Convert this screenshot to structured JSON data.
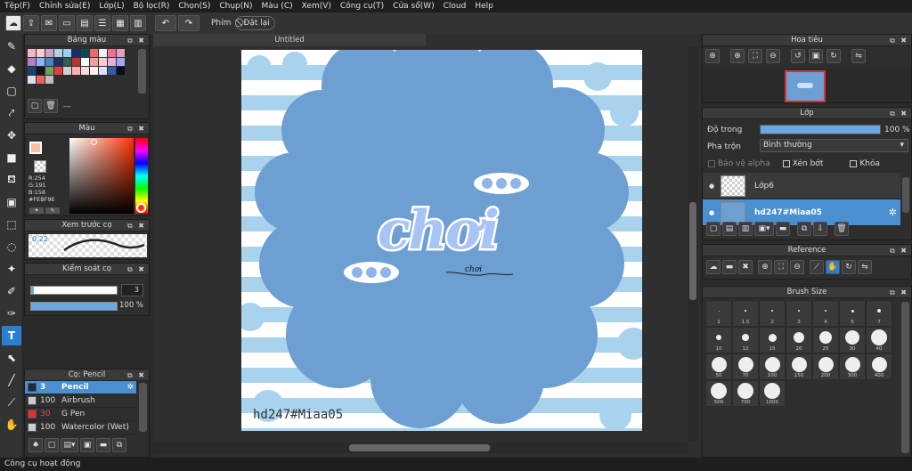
{
  "menu": [
    "Tệp(F)",
    "Chỉnh sửa(E)",
    "Lớp(L)",
    "Bộ lọc(R)",
    "Chọn(S)",
    "Chụp(N)",
    "Màu (C)",
    "Xem(V)",
    "Công cụ(T)",
    "Cửa sổ(W)",
    "Cloud",
    "Help"
  ],
  "toolbar": {
    "keys_label": "Phím",
    "reset_label": "Đặt lại"
  },
  "palette": {
    "title": "Bảng màu",
    "colors": [
      "#f4b6c2",
      "#f9c9d4",
      "#c8a2c8",
      "#b0d0e8",
      "#9ad0f0",
      "#1a2a6a",
      "#0a4a5a",
      "#e86a6a",
      "#f0f0f0",
      "#f07090",
      "#e0a0c0",
      "#b080c0",
      "#8ab4f8",
      "#5080c0",
      "#203060",
      "#306050",
      "#c03030",
      "#ffffff",
      "#f0a0a0",
      "#f8d0d0",
      "#e8b0e0",
      "#a0a8f0",
      "#204070",
      "#101820",
      "#70a060",
      "#e04040",
      "#d0d0d0",
      "#ffb0b0",
      "#ffd8e0",
      "#fff0f0",
      "#e0e0ff",
      "#3060a0",
      "#0a0a20",
      "#d8e0f0",
      "#f06060",
      "#c0c0c0"
    ],
    "footer_label": "---"
  },
  "color_panel": {
    "title": "Màu",
    "r": "R:254",
    "g": "G:191",
    "b": "B:158",
    "hex": "#FEBF9E",
    "main_color": "#febf9e",
    "hue_color": "#ff3300"
  },
  "brush_preview": {
    "title": "Xem trước cọ",
    "size_value": "0.22"
  },
  "brush_control": {
    "title": "Kiểm soát cọ",
    "size": "3",
    "opacity": "100 %",
    "size_fraction": 0.03,
    "opacity_fraction": 1.0
  },
  "brush_list": {
    "title": "Cọ: Pencil",
    "items": [
      {
        "size": "3",
        "name": "Pencil",
        "color": "#1a2a40",
        "selected": true
      },
      {
        "size": "100",
        "name": "Airbrush",
        "color": "#cccccc",
        "selected": false
      },
      {
        "size": "30",
        "name": "G Pen",
        "color": "#e03030",
        "selected": false
      },
      {
        "size": "100",
        "name": "Watercolor (Wet)",
        "color": "#cccccc",
        "selected": false
      }
    ]
  },
  "document": {
    "tab_title": "Untitled",
    "art_title": "chơi",
    "art_small_text": "chơi",
    "watermark": "hd247#Miaa05"
  },
  "navigator": {
    "title": "Hoa tiêu"
  },
  "layers": {
    "title": "Lớp",
    "opacity_label": "Độ trong",
    "opacity_value": "100 %",
    "opacity_fraction": 1.0,
    "blend_label": "Pha trộn",
    "blend_value": "Bình thường",
    "protect_alpha": "Bảo vệ alpha",
    "clipping": "Xén bớt",
    "lock": "Khóa",
    "items": [
      {
        "name": "Lớp6",
        "selected": false
      },
      {
        "name": "hd247#Miaa05",
        "selected": true
      }
    ]
  },
  "reference": {
    "title": "Reference"
  },
  "brush_size": {
    "title": "Brush Size",
    "sizes": [
      "1",
      "1.5",
      "2",
      "3",
      "4",
      "5",
      "7",
      "10",
      "12",
      "15",
      "20",
      "25",
      "30",
      "40",
      "50",
      "70",
      "100",
      "150",
      "200",
      "300",
      "400",
      "500",
      "700",
      "1000"
    ]
  },
  "status": {
    "text": "Công cụ hoạt động"
  }
}
